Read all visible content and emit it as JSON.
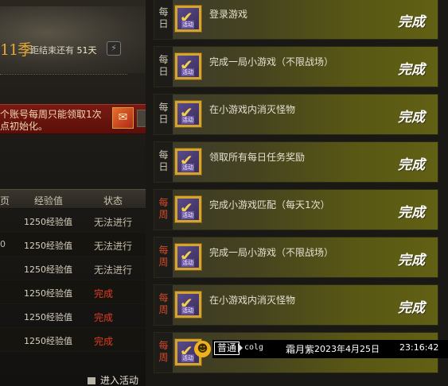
{
  "season": {
    "number_text": "11季",
    "end_label": "距结束还有",
    "days_left": "51天"
  },
  "notice": {
    "line1": "个账号每周只能领取1次",
    "line2": "点初始化。"
  },
  "progress_table": {
    "headers": [
      "页",
      "经验值",
      "状态"
    ],
    "rows": [
      {
        "edge": "",
        "exp": "1250经验值",
        "status": "无法进行",
        "done": false
      },
      {
        "edge": "0",
        "exp": "1250经验值",
        "status": "无法进行",
        "done": false
      },
      {
        "edge": "",
        "exp": "1250经验值",
        "status": "无法进行",
        "done": false
      },
      {
        "edge": "",
        "exp": "1250经验值",
        "status": "完成",
        "done": true
      },
      {
        "edge": "",
        "exp": "1250经验值",
        "status": "完成",
        "done": true
      },
      {
        "edge": "",
        "exp": "1250经验值",
        "status": "完成",
        "done": true
      }
    ]
  },
  "activity_link": "进入活动",
  "icon_tag": "活动",
  "tasks": [
    {
      "cycle": "每日",
      "type": "daily",
      "name": "登录游戏",
      "status": "完成"
    },
    {
      "cycle": "每日",
      "type": "daily",
      "name": "完成一局小游戏（不限战场）",
      "status": "完成"
    },
    {
      "cycle": "每日",
      "type": "daily",
      "name": "在小游戏内消灭怪物",
      "status": "完成"
    },
    {
      "cycle": "每日",
      "type": "daily",
      "name": "领取所有每日任务奖励",
      "status": "完成"
    },
    {
      "cycle": "每周",
      "type": "weekly",
      "name": "完成小游戏匹配（每天1次）",
      "status": "完成"
    },
    {
      "cycle": "每周",
      "type": "weekly",
      "name": "完成一局小游戏（不限战场）",
      "status": "完成"
    },
    {
      "cycle": "每周",
      "type": "weekly",
      "name": "在小游戏内消灭怪物",
      "status": "完成"
    },
    {
      "cycle": "每周",
      "type": "weekly",
      "name": "",
      "status": ""
    }
  ],
  "chat": {
    "channel": "普通",
    "server": "colg",
    "user": "霜月紫",
    "date": "2023年4月25日",
    "time": "23:16:42"
  },
  "colors": {
    "daily_label": "#cfc7b5",
    "weekly_label": "#d24a2a",
    "done_red": "#e23a22",
    "season_gold": "#e1a63a"
  }
}
